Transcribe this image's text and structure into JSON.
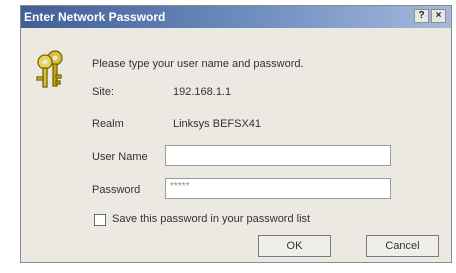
{
  "dialog": {
    "title": "Enter Network Password",
    "help_glyph": "?",
    "close_glyph": "×",
    "prompt": "Please type your user name and password.",
    "site_label": "Site:",
    "site_value": "192.168.1.1",
    "realm_label": "Realm",
    "realm_value": "Linksys BEFSX41",
    "username_label": "User Name",
    "username_value": "",
    "password_label": "Password",
    "password_value": "*****",
    "save_label": "Save this password in your password list",
    "save_checked": false,
    "ok_label": "OK",
    "cancel_label": "Cancel",
    "icon": "keys-icon"
  }
}
